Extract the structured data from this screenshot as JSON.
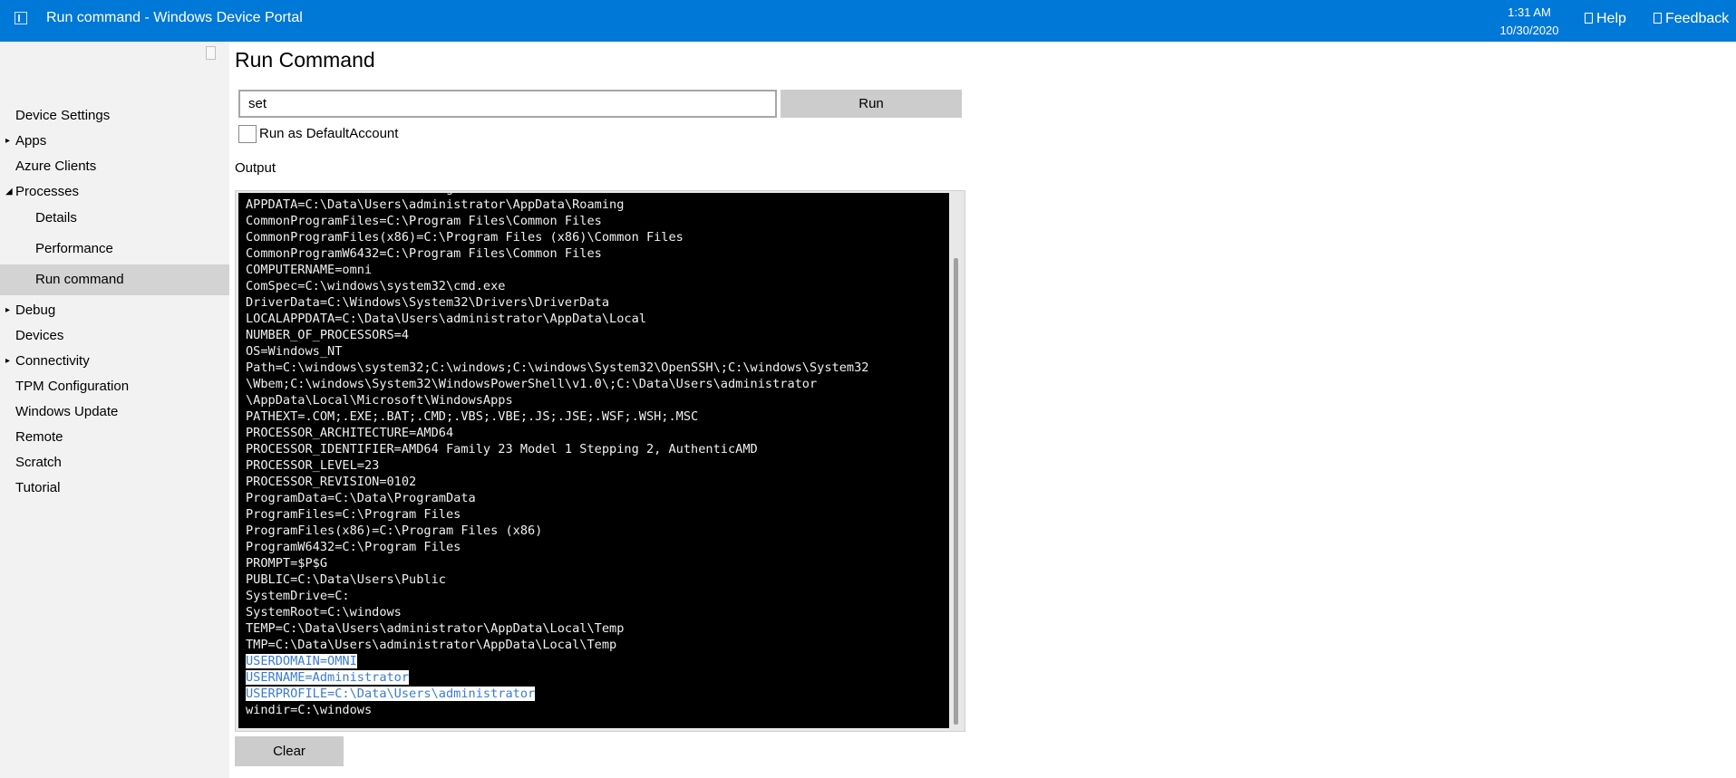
{
  "header": {
    "title": "Run command - Windows Device Portal",
    "time": "1:31 AM",
    "date": "10/30/2020",
    "help_label": "Help",
    "feedback_label": "Feedback",
    "background_color": "#0078d7"
  },
  "sidebar": {
    "items": [
      {
        "label": "Device Settings",
        "expandable": false,
        "level": 0
      },
      {
        "label": "Apps",
        "expandable": true,
        "expanded": false,
        "level": 0
      },
      {
        "label": "Azure Clients",
        "expandable": false,
        "level": 0
      },
      {
        "label": "Processes",
        "expandable": true,
        "expanded": true,
        "level": 0
      },
      {
        "label": "Details",
        "level": 1
      },
      {
        "label": "Performance",
        "level": 1
      },
      {
        "label": "Run command",
        "level": 1,
        "active": true
      },
      {
        "label": "Debug",
        "expandable": true,
        "expanded": false,
        "level": 0
      },
      {
        "label": "Devices",
        "level": 0
      },
      {
        "label": "Connectivity",
        "expandable": true,
        "expanded": false,
        "level": 0
      },
      {
        "label": "TPM Configuration",
        "level": 0
      },
      {
        "label": "Windows Update",
        "level": 0
      },
      {
        "label": "Remote",
        "level": 0
      },
      {
        "label": "Scratch",
        "level": 0
      },
      {
        "label": "Tutorial",
        "level": 0
      }
    ],
    "collapsed_arrow": "▸",
    "expanded_arrow": "◢"
  },
  "main": {
    "title": "Run Command",
    "command_value": "set",
    "run_label": "Run",
    "run_as_label": "Run as DefaultAccount",
    "output_label": "Output",
    "clear_label": "Clear",
    "output_lines": [
      "ALLUSERSPROFILE=C:\\Data\\ProgramData",
      "APPDATA=C:\\Data\\Users\\administrator\\AppData\\Roaming",
      "CommonProgramFiles=C:\\Program Files\\Common Files",
      "CommonProgramFiles(x86)=C:\\Program Files (x86)\\Common Files",
      "CommonProgramW6432=C:\\Program Files\\Common Files",
      "COMPUTERNAME=omni",
      "ComSpec=C:\\windows\\system32\\cmd.exe",
      "DriverData=C:\\Windows\\System32\\Drivers\\DriverData",
      "LOCALAPPDATA=C:\\Data\\Users\\administrator\\AppData\\Local",
      "NUMBER_OF_PROCESSORS=4",
      "OS=Windows_NT",
      "Path=C:\\windows\\system32;C:\\windows;C:\\windows\\System32\\OpenSSH\\;C:\\windows\\System32",
      "\\Wbem;C:\\windows\\System32\\WindowsPowerShell\\v1.0\\;C:\\Data\\Users\\administrator",
      "\\AppData\\Local\\Microsoft\\WindowsApps",
      "PATHEXT=.COM;.EXE;.BAT;.CMD;.VBS;.VBE;.JS;.JSE;.WSF;.WSH;.MSC",
      "PROCESSOR_ARCHITECTURE=AMD64",
      "PROCESSOR_IDENTIFIER=AMD64 Family 23 Model 1 Stepping 2, AuthenticAMD",
      "PROCESSOR_LEVEL=23",
      "PROCESSOR_REVISION=0102",
      "ProgramData=C:\\Data\\ProgramData",
      "ProgramFiles=C:\\Program Files",
      "ProgramFiles(x86)=C:\\Program Files (x86)",
      "ProgramW6432=C:\\Program Files",
      "PROMPT=$P$G",
      "PUBLIC=C:\\Data\\Users\\Public",
      "SystemDrive=C:",
      "SystemRoot=C:\\windows",
      "TEMP=C:\\Data\\Users\\administrator\\AppData\\Local\\Temp",
      "TMP=C:\\Data\\Users\\administrator\\AppData\\Local\\Temp",
      "USERDOMAIN=OMNI",
      "USERNAME=Administrator",
      "USERPROFILE=C:\\Data\\Users\\administrator",
      "windir=C:\\windows"
    ],
    "selected_lines": [
      29,
      30,
      31
    ]
  }
}
